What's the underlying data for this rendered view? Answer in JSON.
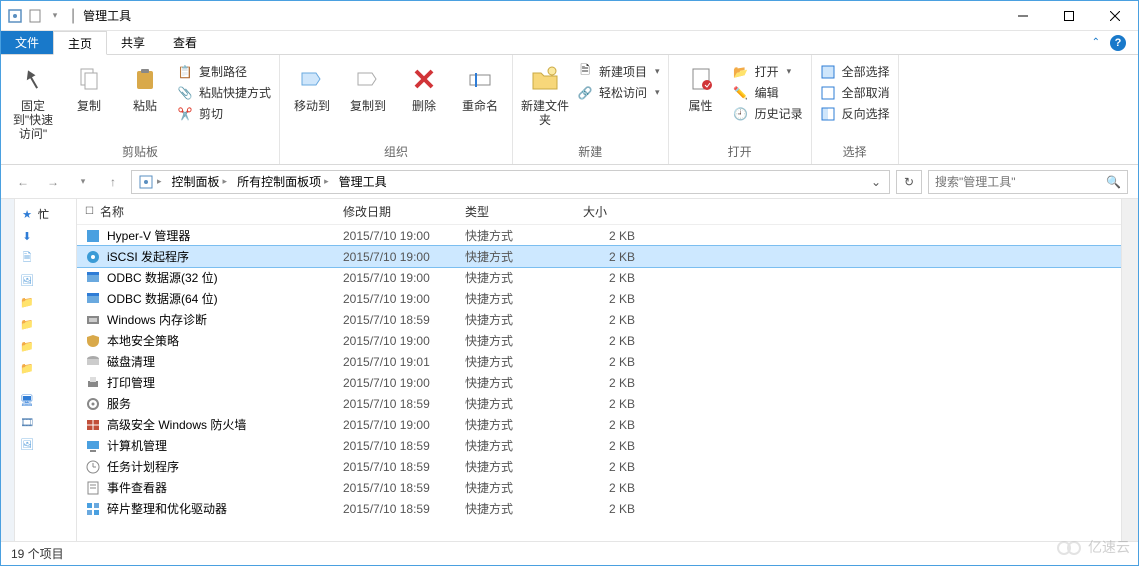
{
  "title": "管理工具",
  "menutabs": {
    "file": "文件",
    "home": "主页",
    "share": "共享",
    "view": "查看"
  },
  "ribbon": {
    "group1_label": "剪贴板",
    "group2_label": "组织",
    "group3_label": "新建",
    "group4_label": "打开",
    "group5_label": "选择",
    "pin": "固定到\"快速访问\"",
    "copy": "复制",
    "paste": "粘贴",
    "copypath": "复制路径",
    "pasteshortcut": "粘贴快捷方式",
    "cut": "剪切",
    "moveto": "移动到",
    "copyto": "复制到",
    "delete": "删除",
    "rename": "重命名",
    "newfolder": "新建文件夹",
    "newitem": "新建项目",
    "easyaccess": "轻松访问",
    "properties": "属性",
    "open": "打开",
    "edit": "编辑",
    "history": "历史记录",
    "selectall": "全部选择",
    "selectnone": "全部取消",
    "invertsel": "反向选择"
  },
  "breadcrumb": {
    "items": [
      "控制面板",
      "所有控制面板项",
      "管理工具"
    ]
  },
  "search_placeholder": "搜索\"管理工具\"",
  "columns": {
    "name": "名称",
    "date": "修改日期",
    "type": "类型",
    "size": "大小"
  },
  "tree": {
    "fav_char": "忙"
  },
  "rows": [
    {
      "name": "Hyper-V 管理器",
      "date": "2015/7/10 19:00",
      "type": "快捷方式",
      "size": "2 KB",
      "icon": "hv"
    },
    {
      "name": "iSCSI 发起程序",
      "date": "2015/7/10 19:00",
      "type": "快捷方式",
      "size": "2 KB",
      "icon": "iscsi",
      "selected": true
    },
    {
      "name": "ODBC 数据源(32 位)",
      "date": "2015/7/10 19:00",
      "type": "快捷方式",
      "size": "2 KB",
      "icon": "odbc"
    },
    {
      "name": "ODBC 数据源(64 位)",
      "date": "2015/7/10 19:00",
      "type": "快捷方式",
      "size": "2 KB",
      "icon": "odbc"
    },
    {
      "name": "Windows 内存诊断",
      "date": "2015/7/10 18:59",
      "type": "快捷方式",
      "size": "2 KB",
      "icon": "mem"
    },
    {
      "name": "本地安全策略",
      "date": "2015/7/10 19:00",
      "type": "快捷方式",
      "size": "2 KB",
      "icon": "sec"
    },
    {
      "name": "磁盘清理",
      "date": "2015/7/10 19:01",
      "type": "快捷方式",
      "size": "2 KB",
      "icon": "disk"
    },
    {
      "name": "打印管理",
      "date": "2015/7/10 19:00",
      "type": "快捷方式",
      "size": "2 KB",
      "icon": "print"
    },
    {
      "name": "服务",
      "date": "2015/7/10 18:59",
      "type": "快捷方式",
      "size": "2 KB",
      "icon": "svc"
    },
    {
      "name": "高级安全 Windows 防火墙",
      "date": "2015/7/10 19:00",
      "type": "快捷方式",
      "size": "2 KB",
      "icon": "fw"
    },
    {
      "name": "计算机管理",
      "date": "2015/7/10 18:59",
      "type": "快捷方式",
      "size": "2 KB",
      "icon": "comp"
    },
    {
      "name": "任务计划程序",
      "date": "2015/7/10 18:59",
      "type": "快捷方式",
      "size": "2 KB",
      "icon": "task"
    },
    {
      "name": "事件查看器",
      "date": "2015/7/10 18:59",
      "type": "快捷方式",
      "size": "2 KB",
      "icon": "event"
    },
    {
      "name": "碎片整理和优化驱动器",
      "date": "2015/7/10 18:59",
      "type": "快捷方式",
      "size": "2 KB",
      "icon": "defrag"
    }
  ],
  "status": "19 个项目",
  "watermark": "亿速云"
}
